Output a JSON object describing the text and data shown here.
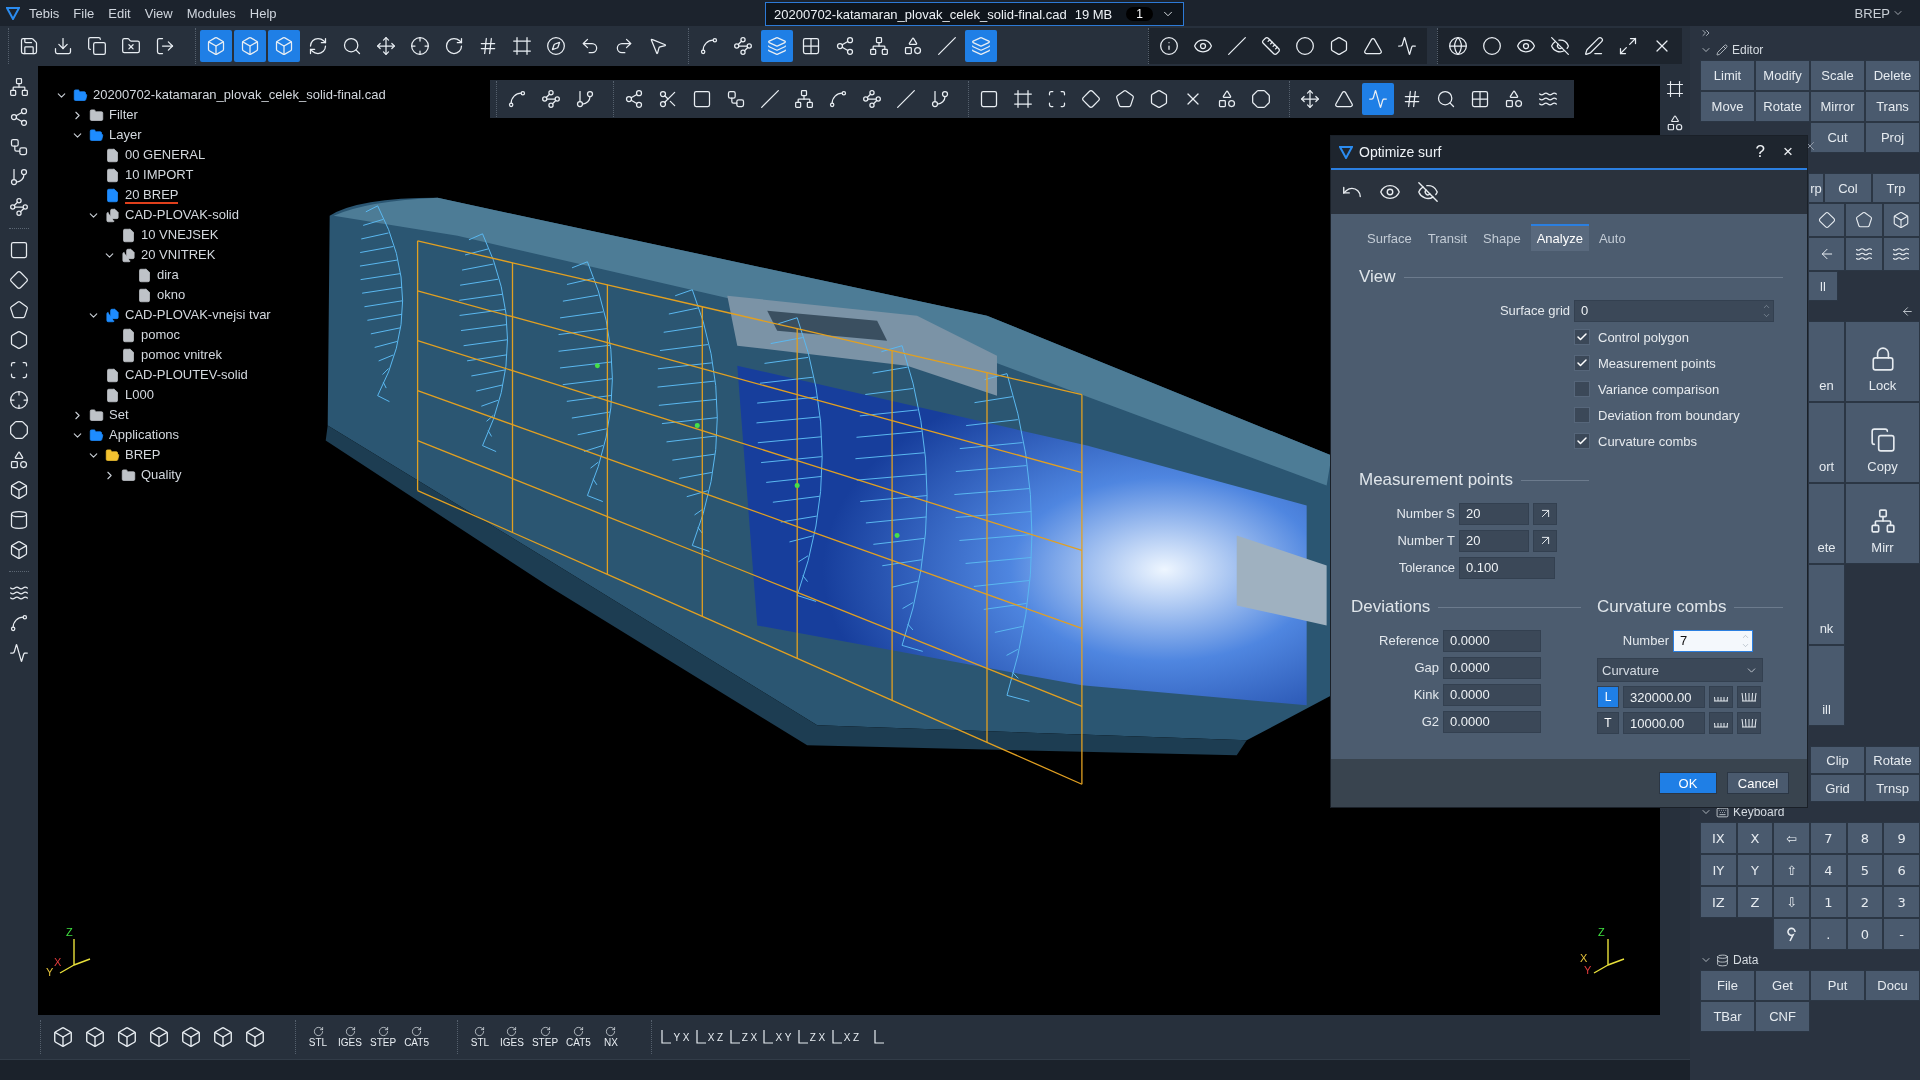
{
  "menu": [
    "Tebis",
    "File",
    "Edit",
    "View",
    "Modules",
    "Help"
  ],
  "document_tab": {
    "title": "20200702-katamaran_plovak_celek_solid-final.cad",
    "size": "19 MB",
    "count": "1"
  },
  "mode": "BREP",
  "main_toolbar": [
    [
      {
        "selected": false
      },
      {
        "selected": false
      },
      {
        "selected": false
      },
      {
        "selected": false
      },
      {
        "selected": false
      }
    ],
    [
      {
        "selected": true
      },
      {
        "selected": true
      },
      {
        "selected": true
      },
      {
        "selected": false
      },
      {
        "selected": false
      },
      {
        "selected": false
      },
      {
        "selected": false
      },
      {
        "selected": false
      },
      {
        "selected": false
      },
      {
        "selected": false
      },
      {
        "selected": false
      },
      {
        "selected": false
      },
      {
        "selected": false
      },
      {
        "selected": false
      }
    ],
    [
      {
        "selected": false
      },
      {
        "selected": false
      },
      {
        "selected": true
      },
      {
        "selected": false
      },
      {
        "selected": false
      },
      {
        "selected": false
      },
      {
        "selected": false
      },
      {
        "selected": false
      },
      {
        "selected": true
      }
    ],
    [
      {
        "selected": false
      },
      {
        "selected": false
      },
      {
        "selected": false
      },
      {
        "selected": false
      },
      {
        "selected": false
      },
      {
        "selected": false
      },
      {
        "selected": false
      },
      {
        "selected": false
      }
    ],
    [
      {
        "selected": false
      },
      {
        "selected": false
      },
      {
        "selected": false
      },
      {
        "selected": false
      },
      {
        "selected": false
      },
      {
        "selected": false
      },
      {
        "selected": false
      }
    ]
  ],
  "viewport_toolbar": [
    [
      {
        "selected": false
      },
      {
        "selected": false
      },
      {
        "selected": false
      }
    ],
    [
      {
        "selected": false
      },
      {
        "selected": false
      },
      {
        "selected": false
      },
      {
        "selected": false
      },
      {
        "selected": false
      },
      {
        "selected": false
      },
      {
        "selected": false
      },
      {
        "selected": false
      },
      {
        "selected": false
      },
      {
        "selected": false
      }
    ],
    [
      {
        "selected": false
      },
      {
        "selected": false
      },
      {
        "selected": false
      },
      {
        "selected": false
      },
      {
        "selected": false
      },
      {
        "selected": false
      },
      {
        "selected": false
      },
      {
        "selected": false
      },
      {
        "selected": false
      }
    ],
    [
      {
        "selected": false
      },
      {
        "selected": false
      },
      {
        "selected": true
      },
      {
        "selected": false
      },
      {
        "selected": false
      },
      {
        "selected": false
      },
      {
        "selected": false
      },
      {
        "selected": false
      }
    ]
  ],
  "tree": [
    {
      "label": "20200702-katamaran_plovak_celek_solid-final.cad",
      "kind": "open-folder",
      "color": "#1e8cff",
      "expanded": true,
      "children": [
        {
          "label": "Filter",
          "kind": "folder",
          "color": "#bfc3c8",
          "expanded": false
        },
        {
          "label": "Layer",
          "kind": "open-folder",
          "color": "#1e8cff",
          "expanded": true,
          "children": [
            {
              "label": "00 GENERAL",
              "kind": "document",
              "color": "#bfc3c8",
              "active": false
            },
            {
              "label": "10 IMPORT",
              "kind": "blank",
              "color": "#bfc3c8",
              "active": false
            },
            {
              "label": "20 BREP",
              "kind": "document",
              "color": "#1e8cff",
              "active": true
            },
            {
              "label": "CAD-PLOVAK-solid",
              "kind": "group",
              "color": "#bfc3c8",
              "active": false,
              "expanded": true,
              "children": [
                {
                  "label": "10 VNEJSEK",
                  "kind": "blank",
                  "color": "#bfc3c8"
                },
                {
                  "label": "20 VNITREK",
                  "kind": "group",
                  "color": "#bfc3c8",
                  "expanded": true,
                  "children": [
                    {
                      "label": "dira",
                      "kind": "document",
                      "color": "#bfc3c8"
                    },
                    {
                      "label": "okno",
                      "kind": "document",
                      "color": "#bfc3c8"
                    }
                  ]
                }
              ]
            },
            {
              "label": "CAD-PLOVAK-vnejsi tvar",
              "kind": "group",
              "color": "#1e8cff",
              "active": false,
              "expanded": true,
              "children": [
                {
                  "label": "pomoc",
                  "kind": "document",
                  "color": "#bfc3c8"
                },
                {
                  "label": "pomoc vnitrek",
                  "kind": "blank",
                  "color": "#bfc3c8"
                }
              ]
            },
            {
              "label": "CAD-PLOUTEV-solid",
              "kind": "document",
              "color": "#bfc3c8",
              "active": false
            },
            {
              "label": "L000",
              "kind": "document",
              "color": "#bfc3c8",
              "active": false
            }
          ]
        },
        {
          "label": "Set",
          "kind": "folder",
          "color": "#bfc3c8",
          "expanded": false
        },
        {
          "label": "Applications",
          "kind": "open-folder",
          "color": "#1e8cff",
          "expanded": true,
          "children": [
            {
              "label": "BREP",
              "kind": "open-folder",
              "color": "#f2c230",
              "expanded": true,
              "children": [
                {
                  "label": "Quality",
                  "kind": "folder",
                  "color": "#bfc3c8",
                  "expanded": false
                }
              ]
            }
          ]
        }
      ]
    }
  ],
  "triads": [
    {
      "labels": [
        "Z",
        "X",
        "Y"
      ]
    },
    {
      "labels": [
        "Z",
        "Y",
        "X"
      ]
    }
  ],
  "bottom_toolbar": [
    {
      "kind": "view"
    },
    {
      "kind": "view"
    },
    {
      "kind": "view"
    },
    {
      "kind": "view"
    },
    {
      "kind": "view"
    },
    {
      "kind": "view"
    },
    {
      "kind": "view"
    },
    {
      "kind": "import",
      "label": "STL"
    },
    {
      "kind": "import",
      "label": "IGES"
    },
    {
      "kind": "import",
      "label": "STEP"
    },
    {
      "kind": "import",
      "label": "CAT5"
    },
    {
      "kind": "export",
      "label": "STL"
    },
    {
      "kind": "export",
      "label": "IGES"
    },
    {
      "kind": "export",
      "label": "STEP"
    },
    {
      "kind": "export",
      "label": "CAT5"
    },
    {
      "kind": "export",
      "label": "NX"
    },
    {
      "kind": "axes",
      "labels": [
        "Y",
        "X"
      ]
    },
    {
      "kind": "axes",
      "labels": [
        "X",
        "Z"
      ]
    },
    {
      "kind": "axes",
      "labels": [
        "Z",
        "X"
      ]
    },
    {
      "kind": "axes",
      "labels": [
        "X",
        "Y"
      ]
    },
    {
      "kind": "axes",
      "labels": [
        "Z",
        "X"
      ]
    },
    {
      "kind": "axes",
      "labels": [
        "X",
        "Z"
      ]
    },
    {
      "kind": "axes"
    }
  ],
  "dialog": {
    "title": "Optimize surf",
    "help": "?",
    "close": "×",
    "tabs": [
      {
        "label": "Surface",
        "selected": false
      },
      {
        "label": "Transit",
        "selected": false
      },
      {
        "label": "Shape",
        "selected": false
      },
      {
        "label": "Analyze",
        "selected": true
      },
      {
        "label": "Auto",
        "selected": false
      }
    ],
    "view": {
      "heading": "View",
      "surface_grid": {
        "label": "Surface grid",
        "value": "0"
      },
      "options": [
        {
          "label": "Control polygon",
          "checked": true
        },
        {
          "label": "Measurement points",
          "checked": true
        },
        {
          "label": "Variance comparison",
          "checked": false
        },
        {
          "label": "Deviation from boundary",
          "checked": false
        },
        {
          "label": "Curvature combs",
          "checked": true
        }
      ]
    },
    "measurement": {
      "heading": "Measurement points",
      "fields": [
        {
          "label": "Number S",
          "value": "20",
          "kind": "pick"
        },
        {
          "label": "Number T",
          "value": "20",
          "kind": "pick"
        },
        {
          "label": "Tolerance",
          "value": "0.100",
          "kind": "plain"
        }
      ]
    },
    "deviations": {
      "heading": "Deviations",
      "fields": [
        {
          "label": "Reference",
          "value": "0.0000"
        },
        {
          "label": "Gap",
          "value": "0.0000"
        },
        {
          "label": "Kink",
          "value": "0.0000"
        },
        {
          "label": "G2",
          "value": "0.0000"
        }
      ]
    },
    "combs": {
      "heading": "Curvature combs",
      "number": {
        "label": "Number",
        "value": "7",
        "focused": true
      },
      "mode": "Curvature",
      "scales": [
        {
          "letter": "L",
          "value": "320000.00",
          "selected": true
        },
        {
          "letter": "T",
          "value": "10000.00",
          "selected": false
        }
      ]
    },
    "buttons": [
      {
        "label": "OK",
        "primary": true
      },
      {
        "label": "Cancel",
        "primary": false
      }
    ]
  },
  "editor": {
    "title": "Editor",
    "rows": [
      [
        "Limit",
        "Modify",
        "Scale",
        "Delete"
      ],
      [
        "Move",
        "Rotate",
        "Mirror",
        "Trans"
      ],
      [
        "",
        "",
        "Cut",
        "Proj"
      ]
    ]
  },
  "hidden_tabs": [
    "rp",
    "Col",
    "Trp"
  ],
  "hidden_row": "ll",
  "tool_cells": [
    {
      "partial": "en",
      "label": "Lock"
    },
    {
      "partial": "ort",
      "label": "Copy"
    },
    {
      "partial": "ete",
      "label": "Mirr"
    },
    {
      "partial": "nk"
    },
    {
      "partial": "ill"
    }
  ],
  "tool_rows": [
    [
      "Clip",
      "Rotate"
    ],
    [
      "Grid",
      "Trnsp"
    ]
  ],
  "keyboard": {
    "title": "Keyboard",
    "keys": [
      {
        "kind": "key",
        "label": "IX"
      },
      {
        "kind": "key",
        "label": "X"
      },
      {
        "kind": "key",
        "label": "⇦"
      },
      {
        "kind": "key",
        "label": "7"
      },
      {
        "kind": "key",
        "label": "8"
      },
      {
        "kind": "key",
        "label": "9"
      },
      {
        "kind": "key",
        "label": "IY"
      },
      {
        "kind": "key",
        "label": "Y"
      },
      {
        "kind": "key",
        "label": "⇧"
      },
      {
        "kind": "key",
        "label": "4"
      },
      {
        "kind": "key",
        "label": "5"
      },
      {
        "kind": "key",
        "label": "6"
      },
      {
        "kind": "key",
        "label": "IZ"
      },
      {
        "kind": "key",
        "label": "Z"
      },
      {
        "kind": "key",
        "label": "⇩"
      },
      {
        "kind": "key",
        "label": "1"
      },
      {
        "kind": "key",
        "label": "2"
      },
      {
        "kind": "key",
        "label": "3"
      },
      {
        "kind": "blank"
      },
      {
        "kind": "blank"
      },
      {
        "kind": "enter"
      },
      {
        "kind": "key",
        "label": "."
      },
      {
        "kind": "key",
        "label": "0"
      },
      {
        "kind": "key",
        "label": "-"
      }
    ]
  },
  "data": {
    "title": "Data",
    "buttons": [
      "File",
      "Get",
      "Put",
      "Docu",
      "TBar",
      "CNF"
    ]
  }
}
